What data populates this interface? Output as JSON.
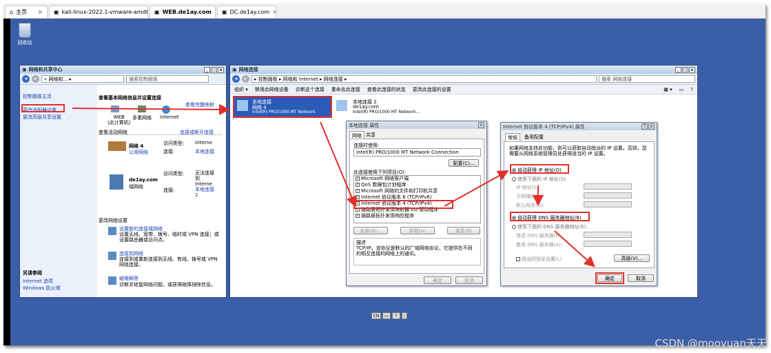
{
  "browser_tabs": [
    {
      "label": "主页",
      "icon": "home-icon"
    },
    {
      "label": "kali-linux-2022.1-vmware-amd64",
      "icon": "vm-icon"
    },
    {
      "label": "WEB.de1ay.com",
      "icon": "vm-icon",
      "active": true
    },
    {
      "label": "DC.de1ay.com",
      "icon": "vm-icon"
    }
  ],
  "desktop": {
    "recycle_label": "回收站"
  },
  "network_center": {
    "title": "网络和共享中心",
    "breadcrumb": "« 网络和... ▸",
    "search_placeholder": "搜索控制面板",
    "sidebar": [
      "控制面板主页",
      "更改适配器设置",
      "更改高级共享设置"
    ],
    "heading": "查看基本网络信息并设置连接",
    "full_map": "查看完整映射",
    "map_nodes": [
      "WEB\n(此计算机)",
      "多重网络",
      "Internet"
    ],
    "active_heading": "查看活动网络",
    "connect_link": "连接或断开连接",
    "networks": [
      {
        "name": "网络  4",
        "type": "公用网络",
        "access_label": "访问类型:",
        "access_value": "Interne",
        "conn_label": "连接:",
        "conn_value": "本地连接"
      },
      {
        "name": "de1ay.com",
        "type": "域网络",
        "access_label": "访问类型:",
        "access_value": "无法连接到Interne",
        "conn_label": "连接:",
        "conn_value": "本地连接 2"
      }
    ],
    "change_heading": "更改网络设置",
    "tasks": [
      {
        "title": "设置新的连接或网络",
        "desc": "设置无线、宽带、拨号、临时或 VPN 连接；或设置路由器或访问点。"
      },
      {
        "title": "连接到网络",
        "desc": "连接到或重新连接到无线、有线、拨号或 VPN 网络连接。"
      },
      {
        "title": "疑难解答",
        "desc": "诊断并修复网络问题，或获得故障排除信息。"
      }
    ],
    "see_also": "另请参阅",
    "see_also_links": [
      "Internet 选项",
      "Windows 防火墙"
    ]
  },
  "net_connections": {
    "title": "网络连接",
    "breadcrumb": "▸ 控制面板 ▸ 网络和 Internet ▸ 网络连接 ▸",
    "search_placeholder": "搜索 网络连接",
    "toolbar": [
      "组织 ▾",
      "禁用此网络设备",
      "诊断这个连接",
      "重命名此连接",
      "查看此连接的状态",
      "更改此连接的设置"
    ],
    "adapters": [
      {
        "name": "本地连接",
        "network": "网络  4",
        "device": "Intel(R) PRO/1000 MT Network"
      },
      {
        "name": "本地连接 2",
        "network": "de1ay.com",
        "device": "Intel(R) PRO/1000 MT Network..."
      }
    ]
  },
  "props_dialog": {
    "title": "本地连接 属性",
    "tabs": [
      "网络",
      "共享"
    ],
    "connect_using": "连接时使用:",
    "adapter": "Intel(R) PRO/1000 MT Network Connection",
    "configure": "配置(C)...",
    "items_label": "此连接使用下列项目(O):",
    "items": [
      "Microsoft 网络客户端",
      "QoS 数据包计划程序",
      "Microsoft 网络的文件和打印机共享",
      "Internet 协议版本 6 (TCP/IPv6)",
      "Internet 协议版本 4 (TCP/IPv4)",
      "链路层拓扑发现映射器 I/O 驱动程序",
      "链路层拓扑发现响应程序"
    ],
    "install": "安装(N)...",
    "uninstall": "卸载(U)",
    "properties": "属性(R)",
    "desc_label": "描述",
    "desc": "TCP/IP。该协议是默认的广域网络协议，它提供在不同的相互连接的网络上的通讯。",
    "ok": "确定",
    "cancel": "取消"
  },
  "ipv4_dialog": {
    "title": "Internet 协议版本 4 (TCP/IPv4) 属性",
    "tabs": [
      "常规",
      "备用配置"
    ],
    "intro": "如果网络支持此功能，则可以获取自动指派的 IP 设置。否则，您需要从网络系统管理员处获得适当的 IP 设置。",
    "auto_ip": "自动获得 IP 地址(O)",
    "manual_ip": "使用下面的 IP 地址(S):",
    "ip_fields": [
      "IP 地址(I):",
      "子网掩码(U):",
      "默认网关(D):"
    ],
    "auto_dns": "自动获得 DNS 服务器地址(B)",
    "manual_dns": "使用下面的 DNS 服务器地址(E):",
    "dns_fields": [
      "首选 DNS 服务器(P):",
      "备用 DNS 服务器(A):"
    ],
    "validate": "退出时验证设置(L)",
    "advanced": "高级(V)...",
    "ok": "确定",
    "cancel": "取消"
  },
  "taskbar": [
    "CN",
    "?"
  ],
  "watermark": "CSDN @mooyuan天天",
  "colors": {
    "desktop": "#3b5ea8",
    "highlight": "#e0302c",
    "selected": "#2a5bb8"
  }
}
